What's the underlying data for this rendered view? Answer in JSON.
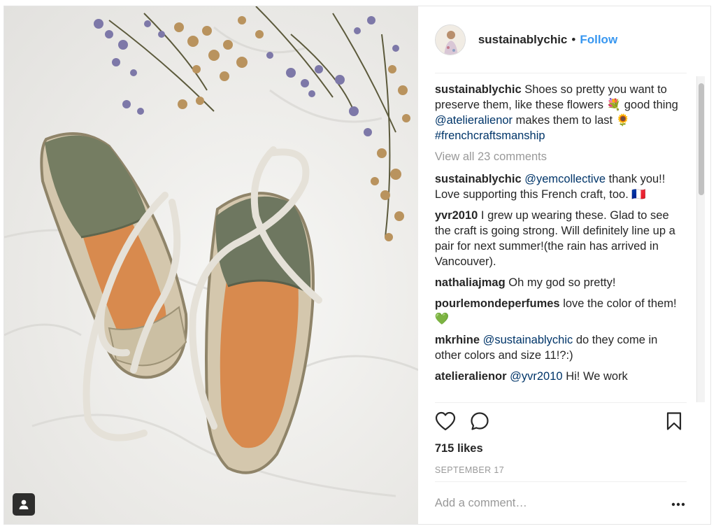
{
  "header": {
    "username": "sustainablychic",
    "separator": "•",
    "follow_label": "Follow"
  },
  "caption": {
    "user": "sustainablychic",
    "text_1": "Shoes so pretty you want to preserve them, like these flowers",
    "emoji_1": "💐",
    "text_2": "good thing",
    "mention": "@atelieralienor",
    "text_3": "makes them to last",
    "emoji_2": "🌻",
    "hashtag": "#frenchcraftsmanship"
  },
  "view_all_comments": "View all 23 comments",
  "comments": [
    {
      "user": "sustainablychic",
      "mention": "@yemcollective",
      "text": "thank you!! Love supporting this French craft, too.",
      "emoji": "🇫🇷"
    },
    {
      "user": "yvr2010",
      "mention": "",
      "text": "I grew up wearing these. Glad to see the craft is going strong. Will definitely line up a pair for next summer!(the rain has arrived in Vancouver).",
      "emoji": ""
    },
    {
      "user": "nathaliajmag",
      "mention": "",
      "text": "Oh my god so pretty!",
      "emoji": ""
    },
    {
      "user": "pourlemondeperfumes",
      "mention": "",
      "text": "love the color of them!",
      "emoji": "💚"
    },
    {
      "user": "mkrhine",
      "mention": "@sustainablychic",
      "text": "do they come in other colors and size 11!?:)",
      "emoji": ""
    },
    {
      "user": "atelieralienor",
      "mention": "@yvr2010",
      "text": "Hi! We work",
      "emoji": ""
    }
  ],
  "likes": "715 likes",
  "date": "SEPTEMBER 17",
  "add_comment_placeholder": "Add a comment…",
  "icons": {
    "like": "heart-icon",
    "comment": "comment-icon",
    "save": "bookmark-icon",
    "more": "more-options-icon",
    "tagged": "user-tag-icon"
  },
  "colors": {
    "follow": "#3897f0",
    "link": "#003569",
    "muted": "#999999"
  }
}
